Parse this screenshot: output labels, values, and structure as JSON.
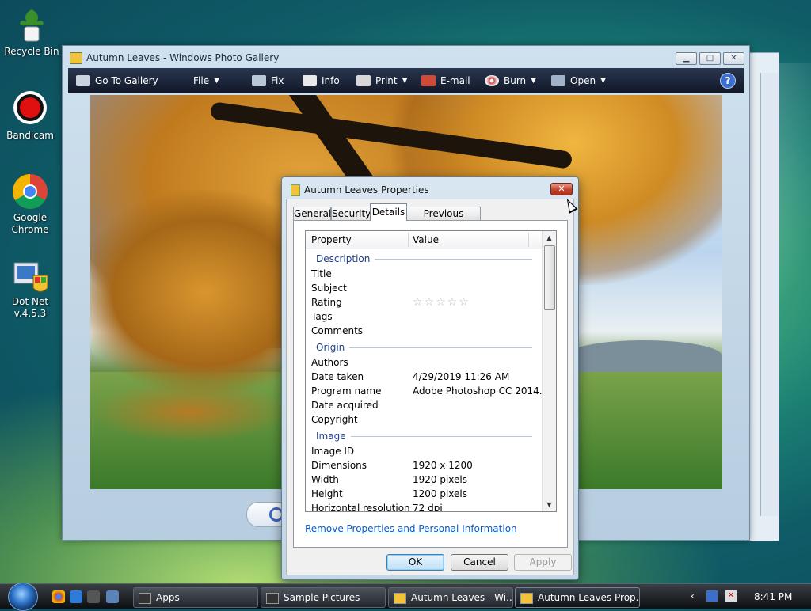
{
  "desktop": {
    "icons": [
      {
        "label": "Recycle Bin"
      },
      {
        "label": "Bandicam"
      },
      {
        "label": "Google Chrome"
      },
      {
        "label": "Dot Net v.4.5.3"
      }
    ]
  },
  "gallery": {
    "title": "Autumn Leaves - Windows Photo Gallery",
    "toolbar": {
      "go_to_gallery": "Go To Gallery",
      "file": "File",
      "fix": "Fix",
      "info": "Info",
      "print": "Print",
      "email": "E-mail",
      "burn": "Burn",
      "open": "Open",
      "help": "?"
    }
  },
  "dialog": {
    "title": "Autumn Leaves Properties",
    "close": "✕",
    "tabs": [
      "General",
      "Security",
      "Details",
      "Previous Versions"
    ],
    "active_tab": "Details",
    "columns": {
      "property": "Property",
      "value": "Value"
    },
    "groups": [
      {
        "name": "Description",
        "rows": [
          {
            "property": "Title",
            "value": ""
          },
          {
            "property": "Subject",
            "value": ""
          },
          {
            "property": "Rating",
            "value": "",
            "stars": 5
          },
          {
            "property": "Tags",
            "value": ""
          },
          {
            "property": "Comments",
            "value": ""
          }
        ]
      },
      {
        "name": "Origin",
        "rows": [
          {
            "property": "Authors",
            "value": ""
          },
          {
            "property": "Date taken",
            "value": "4/29/2019 11:26 AM"
          },
          {
            "property": "Program name",
            "value": "Adobe Photoshop CC 2014..."
          },
          {
            "property": "Date acquired",
            "value": ""
          },
          {
            "property": "Copyright",
            "value": ""
          }
        ]
      },
      {
        "name": "Image",
        "rows": [
          {
            "property": "Image ID",
            "value": ""
          },
          {
            "property": "Dimensions",
            "value": "1920 x 1200"
          },
          {
            "property": "Width",
            "value": "1920 pixels"
          },
          {
            "property": "Height",
            "value": "1200 pixels"
          },
          {
            "property": "Horizontal resolution",
            "value": "72 dpi"
          }
        ]
      }
    ],
    "link": "Remove Properties and Personal Information",
    "buttons": {
      "ok": "OK",
      "cancel": "Cancel",
      "apply": "Apply"
    }
  },
  "taskbar": {
    "buttons": [
      {
        "label": "Apps"
      },
      {
        "label": "Sample Pictures"
      },
      {
        "label": "Autumn Leaves - Wi..."
      },
      {
        "label": "Autumn Leaves Prop..."
      }
    ],
    "clock": "8:41 PM"
  }
}
